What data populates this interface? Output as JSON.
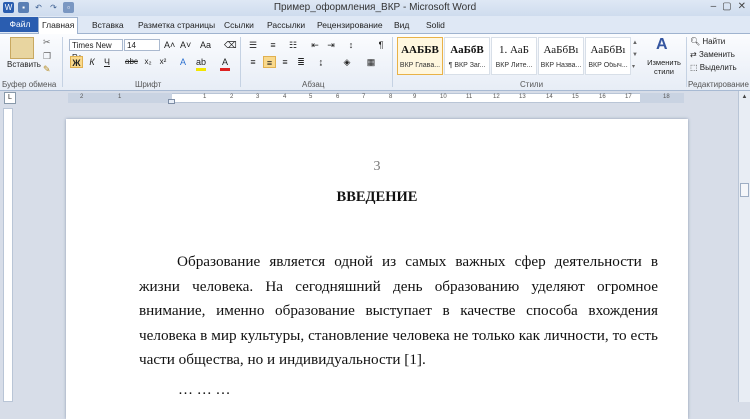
{
  "window": {
    "title": "Пример_оформления_ВКР  -  Microsoft Word",
    "controls": [
      "–",
      "▢",
      "✕"
    ]
  },
  "tabs": [
    "Файл",
    "Главная",
    "Вставка",
    "Разметка страницы",
    "Ссылки",
    "Рассылки",
    "Рецензирование",
    "Вид",
    "Solid"
  ],
  "ribbon": {
    "clipboard": {
      "paste": "Вставить",
      "label": "Буфер обмена"
    },
    "font": {
      "name": "Times New Rc",
      "size": "14",
      "label": "Шрифт",
      "bold": "Ж",
      "italic": "К",
      "underline": "Ч"
    },
    "paragraph": {
      "label": "Абзац"
    },
    "styles": {
      "label": "Стили",
      "items": [
        {
          "preview": "ААББВ",
          "name": "ВКР Главa..."
        },
        {
          "preview": "АаБбВ",
          "name": "¶ ВКР Заг..."
        },
        {
          "preview": "1. АаБ",
          "name": "ВКР Лите..."
        },
        {
          "preview": "АаБбВı",
          "name": "ВКР Назва..."
        },
        {
          "preview": "АаБбВı",
          "name": "ВКР Обыч..."
        }
      ],
      "change": "Изменить стили"
    },
    "editing": {
      "find": "Найти",
      "replace": "Заменить",
      "select": "Выделить",
      "label": "Редактирование"
    }
  },
  "ruler": {
    "ticks": [
      "2",
      "1",
      "1",
      "2",
      "3",
      "4",
      "5",
      "6",
      "7",
      "8",
      "9",
      "10",
      "11",
      "12",
      "13",
      "14",
      "15",
      "16",
      "17",
      "18"
    ]
  },
  "document": {
    "page_number": "3",
    "heading": "ВВЕДЕНИЕ",
    "paragraph": "Образование является одной из самых важных сфер деятельности в жизни человека. На сегодняшний день образованию уделяют огромное внимание, именно образование выступает в качестве способа вхождения человека в мир культуры, становление человека не только как личности, то есть части общества, но и индивидуальности [1].",
    "continuation": "… … …"
  },
  "colors": {
    "file_tab": "#2a5db0",
    "highlight": "#f9d98c",
    "ribbon_bg": "#e7edf6"
  }
}
